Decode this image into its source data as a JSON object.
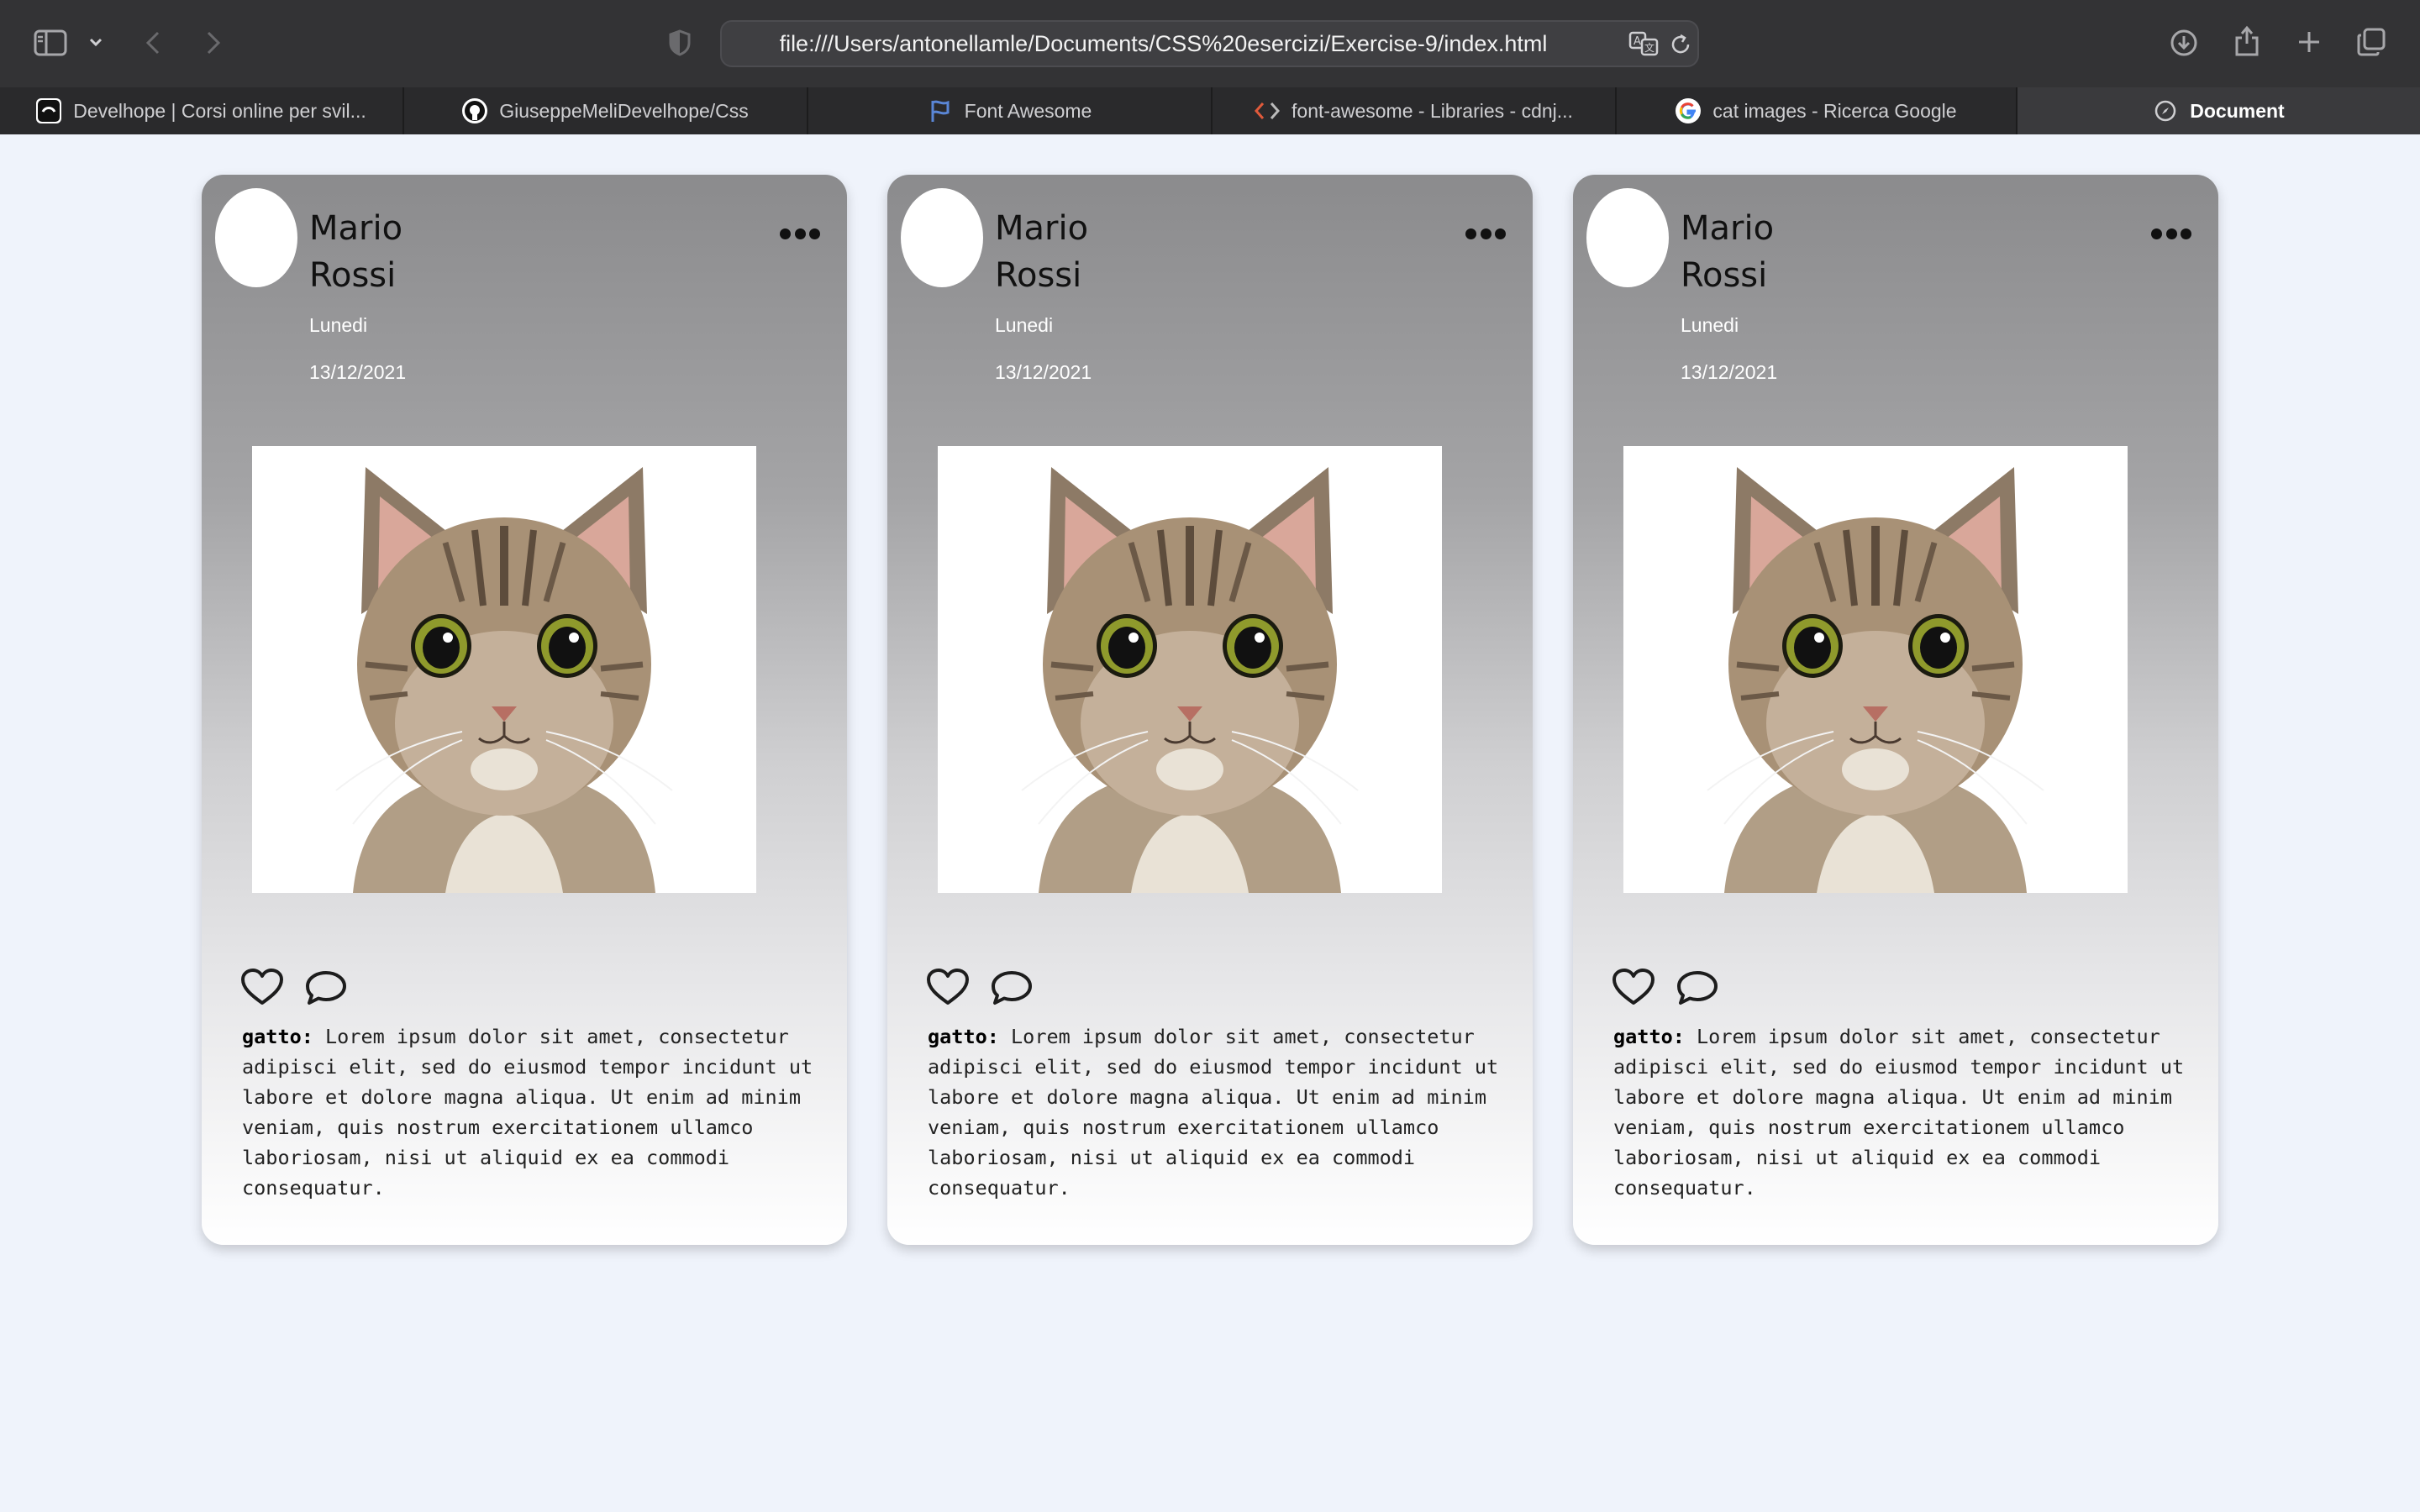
{
  "browser": {
    "url": "file:///Users/antonellamle/Documents/CSS%20esercizi/Exercise-9/index.html",
    "tabs": [
      {
        "label": "Develhope | Corsi online per svil...",
        "icon": "develhope-icon",
        "active": false
      },
      {
        "label": "GiuseppeMeliDevelhope/Css",
        "icon": "github-icon",
        "active": false
      },
      {
        "label": "Font Awesome",
        "icon": "font-awesome-flag-icon",
        "active": false
      },
      {
        "label": "font-awesome - Libraries - cdnj...",
        "icon": "code-brackets-icon",
        "active": false
      },
      {
        "label": "cat images - Ricerca Google",
        "icon": "google-icon",
        "active": false
      },
      {
        "label": "Document",
        "icon": "compass-icon",
        "active": true
      }
    ]
  },
  "cards": [
    {
      "first_name": "Mario",
      "last_name": "Rossi",
      "day": "Lunedi",
      "date": "13/12/2021",
      "caption_label": "gatto:",
      "caption_text": " Lorem ipsum dolor sit amet, consectetur adipisci elit, sed do eiusmod tempor incidunt ut labore et dolore magna aliqua. Ut enim ad minim veniam, quis nostrum exercitationem ullamco laboriosam, nisi ut aliquid ex ea commodi consequatur."
    },
    {
      "first_name": "Mario",
      "last_name": "Rossi",
      "day": "Lunedi",
      "date": "13/12/2021",
      "caption_label": "gatto:",
      "caption_text": " Lorem ipsum dolor sit amet, consectetur adipisci elit, sed do eiusmod tempor incidunt ut labore et dolore magna aliqua. Ut enim ad minim veniam, quis nostrum exercitationem ullamco laboriosam, nisi ut aliquid ex ea commodi consequatur."
    },
    {
      "first_name": "Mario",
      "last_name": "Rossi",
      "day": "Lunedi",
      "date": "13/12/2021",
      "caption_label": "gatto:",
      "caption_text": " Lorem ipsum dolor sit amet, consectetur adipisci elit, sed do eiusmod tempor incidunt ut labore et dolore magna aliqua. Ut enim ad minim veniam, quis nostrum exercitationem ullamco laboriosam, nisi ut aliquid ex ea commodi consequatur."
    }
  ],
  "colors": {
    "page_background": "#eff3fb",
    "toolbar_background": "#333335",
    "card_gradient_top": "#8b8b8d",
    "card_gradient_bottom": "#ffffff"
  }
}
